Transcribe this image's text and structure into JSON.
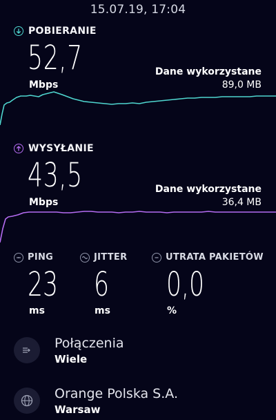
{
  "datetime": "15.07.19, 17:04",
  "download": {
    "title": "POBIERANIE",
    "value": "52,7",
    "unit": "Mbps",
    "used_label": "Dane wykorzystane",
    "used_value": "89,0 MB",
    "color": "#4fd7d0"
  },
  "upload": {
    "title": "WYSYŁANIE",
    "value": "43,5",
    "unit": "Mbps",
    "used_label": "Dane wykorzystane",
    "used_value": "36,4 MB",
    "color": "#b56cf2"
  },
  "metrics": {
    "ping": {
      "title": "PING",
      "value": "23",
      "unit": "ms"
    },
    "jitter": {
      "title": "JITTER",
      "value": "6",
      "unit": "ms"
    },
    "loss": {
      "title": "UTRATA PAKIETÓW",
      "value": "0,0",
      "unit": "%"
    }
  },
  "connections": {
    "title": "Połączenia",
    "value": "Wiele",
    "icon": "connections-icon"
  },
  "provider": {
    "title": "Orange Polska S.A.",
    "value": "Warsaw",
    "icon": "globe-icon"
  }
}
